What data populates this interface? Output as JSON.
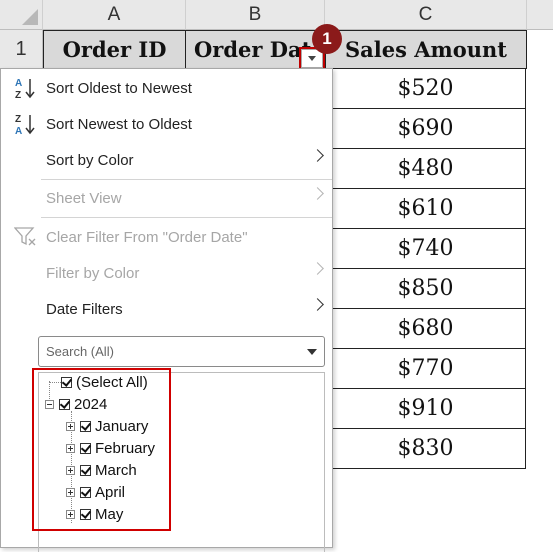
{
  "sheet": {
    "columns": [
      "A",
      "B",
      "C"
    ],
    "row_numbers": [
      "1"
    ],
    "headers": {
      "order_id": "Order ID",
      "order_date": "Order Date",
      "sales_amount": "Sales Amount"
    },
    "sales": [
      "$520",
      "$690",
      "$480",
      "$610",
      "$740",
      "$850",
      "$680",
      "$770",
      "$910",
      "$830"
    ]
  },
  "callout": {
    "number": "1"
  },
  "menu": {
    "sort_asc": "Sort Oldest to Newest",
    "sort_desc": "Sort Newest to Oldest",
    "sort_color": "Sort by Color",
    "sheet_view": "Sheet View",
    "clear_filter": "Clear Filter From \"Order Date\"",
    "filter_color": "Filter by Color",
    "date_filters": "Date Filters",
    "search_placeholder": "Search (All)"
  },
  "tree": {
    "select_all": "(Select All)",
    "year": "2024",
    "months": [
      "January",
      "February",
      "March",
      "April",
      "May"
    ]
  },
  "colors": {
    "highlight": "#d00000",
    "badge": "#8b1a1a",
    "header_fill": "#d9d9d9",
    "sort_blue": "#2e75b6"
  }
}
